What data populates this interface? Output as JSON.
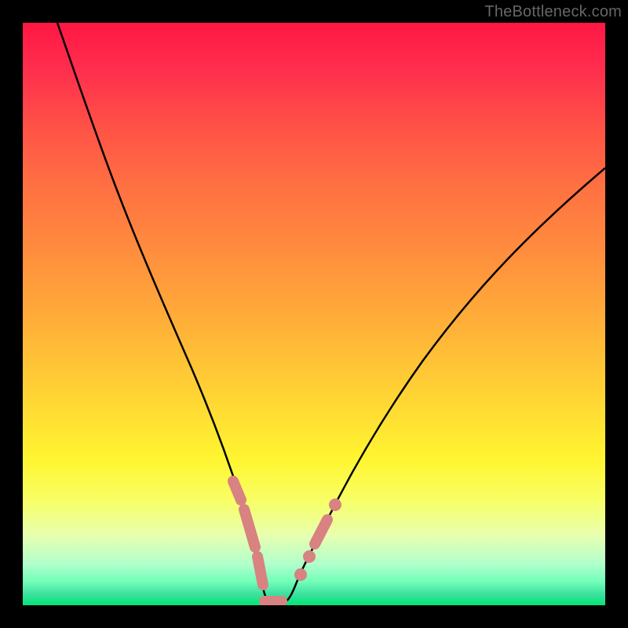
{
  "watermark": "TheBottleneck.com",
  "chart_data": {
    "type": "line",
    "title": "",
    "xlabel": "",
    "ylabel": "",
    "xlim": [
      0,
      100
    ],
    "ylim": [
      0,
      100
    ],
    "grid": false,
    "series": [
      {
        "name": "bottleneck-curve",
        "color": "#000000",
        "x": [
          6,
          10,
          14,
          18,
          22,
          26,
          30,
          33,
          35,
          37,
          39,
          40.5,
          42,
          44,
          47,
          50,
          53,
          57,
          62,
          68,
          75,
          83,
          92,
          100
        ],
        "y": [
          100,
          88,
          76,
          64,
          53,
          42,
          33,
          25,
          19,
          13,
          8,
          4,
          0.5,
          0.5,
          3,
          7,
          12,
          18,
          26,
          35,
          45,
          55,
          66,
          75
        ]
      }
    ],
    "highlights": [
      {
        "name": "segment-1",
        "color": "#e08080",
        "x_range": [
          33,
          35
        ],
        "y_range": [
          25,
          19
        ]
      },
      {
        "name": "segment-2",
        "color": "#e08080",
        "x_range": [
          35,
          40
        ],
        "y_range": [
          19,
          4
        ]
      },
      {
        "name": "segment-bottom",
        "color": "#e08080",
        "x_range": [
          40.5,
          44
        ],
        "y_range": [
          0.5,
          0.5
        ]
      },
      {
        "name": "beads-right-1",
        "color": "#e08080",
        "x_range": [
          47,
          50
        ],
        "y_range": [
          3,
          7
        ]
      },
      {
        "name": "beads-right-2",
        "color": "#e08080",
        "x_range": [
          50,
          53
        ],
        "y_range": [
          7,
          12
        ]
      }
    ]
  }
}
